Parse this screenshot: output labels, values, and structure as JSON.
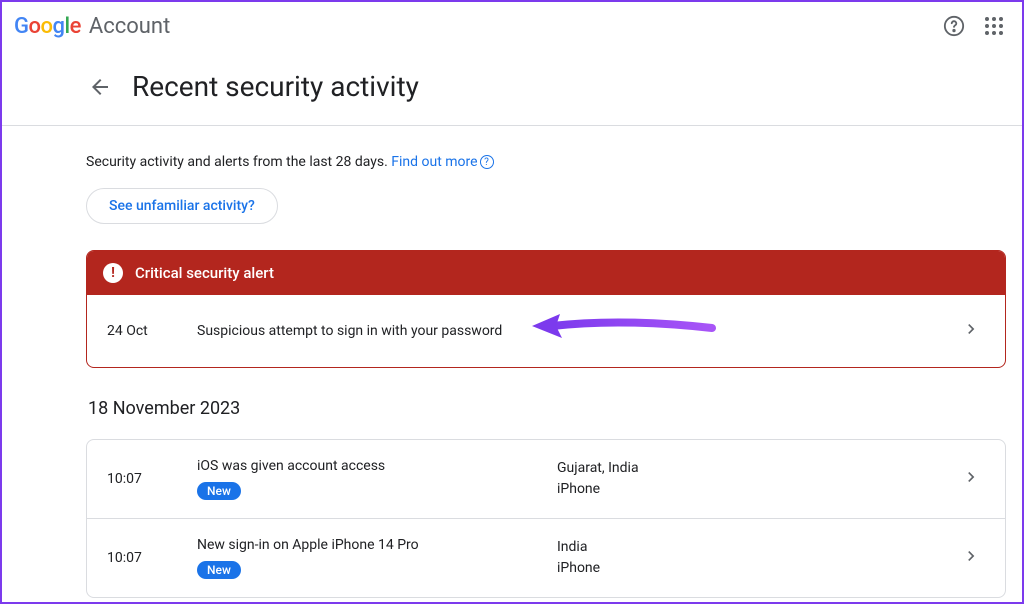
{
  "header": {
    "logo_text": "Google",
    "account_label": "Account"
  },
  "page": {
    "title": "Recent security activity",
    "description_prefix": "Security activity and alerts from the last 28 days. ",
    "find_out_more": "Find out more",
    "unfamiliar_button": "See unfamiliar activity?"
  },
  "alert": {
    "banner_label": "Critical security alert",
    "date": "24 Oct",
    "text": "Suspicious attempt to sign in with your password"
  },
  "section_date": "18 November 2023",
  "events": [
    {
      "time": "10:07",
      "title": "iOS was given account access",
      "new_label": "New",
      "location": "Gujarat, India",
      "device": "iPhone"
    },
    {
      "time": "10:07",
      "title": "New sign-in on Apple iPhone 14 Pro",
      "new_label": "New",
      "location": "India",
      "device": "iPhone"
    }
  ]
}
